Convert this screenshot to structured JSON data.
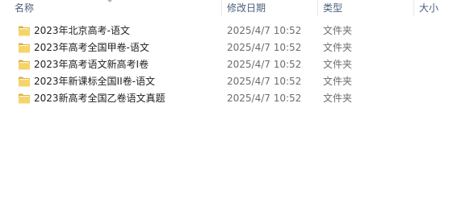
{
  "columns": {
    "name": "名称",
    "date_modified": "修改日期",
    "type": "类型",
    "size": "大小"
  },
  "files": [
    {
      "name": "2023年北京高考-语文",
      "date_modified": "2025/4/7 10:52",
      "type": "文件夹",
      "icon": "folder-icon"
    },
    {
      "name": "2023年高考全国甲卷-语文",
      "date_modified": "2025/4/7 10:52",
      "type": "文件夹",
      "icon": "folder-icon"
    },
    {
      "name": "2023年高考语文新高考I卷",
      "date_modified": "2025/4/7 10:52",
      "type": "文件夹",
      "icon": "folder-icon"
    },
    {
      "name": "2023年新课标全国II卷-语文",
      "date_modified": "2025/4/7 10:52",
      "type": "文件夹",
      "icon": "folder-icon"
    },
    {
      "name": "2023新高考全国乙卷语文真题",
      "date_modified": "2025/4/7 10:52",
      "type": "文件夹",
      "icon": "folder-icon"
    }
  ],
  "colors": {
    "header_text": "#4c607a",
    "folder_yellow": "#f0c84a",
    "secondary_text": "#6d6d6d"
  }
}
